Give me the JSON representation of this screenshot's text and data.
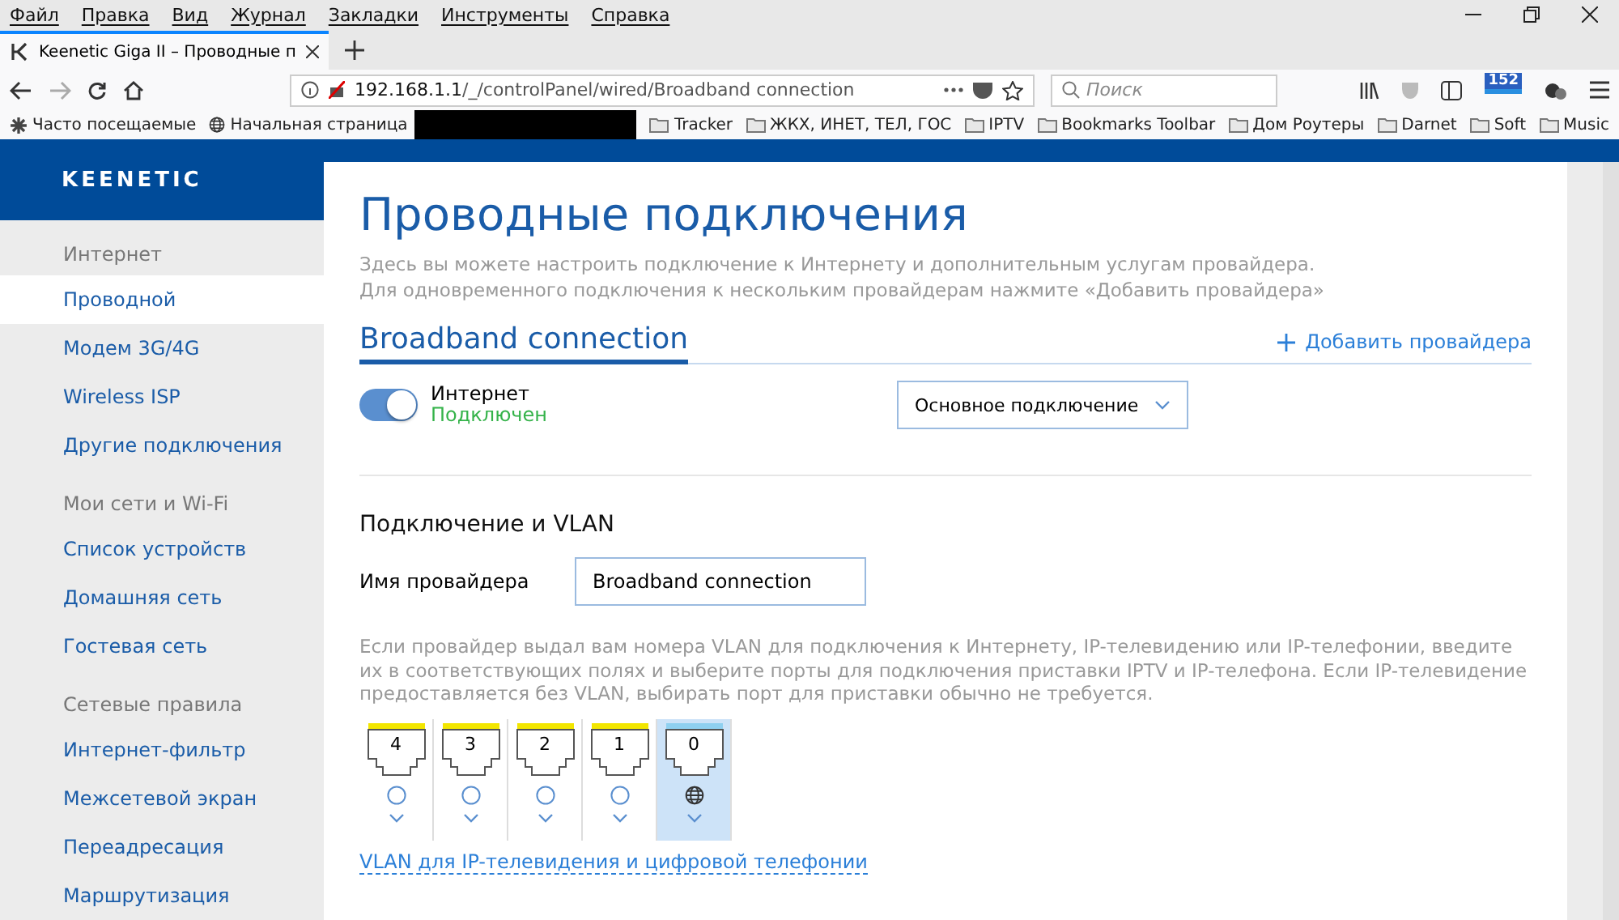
{
  "menu_bar": [
    "Файл",
    "Правка",
    "Вид",
    "Журнал",
    "Закладки",
    "Инструменты",
    "Справка"
  ],
  "tab": {
    "title": "Keenetic Giga II – Проводные п",
    "selected": true
  },
  "address": {
    "host": "192.168.1.1",
    "path": "/_/controlPanel/wired/Broadband connection"
  },
  "search": {
    "placeholder": "Поиск"
  },
  "notification_badge": "152",
  "bookmarks": [
    {
      "label": "Часто посещаемые",
      "kind": "gear"
    },
    {
      "label": "Начальная страница",
      "kind": "globe"
    },
    {
      "label": "Tracker",
      "kind": "folder"
    },
    {
      "label": "ЖКХ, ИНЕТ, ТЕЛ, ГОС",
      "kind": "folder"
    },
    {
      "label": "IPTV",
      "kind": "folder"
    },
    {
      "label": "Bookmarks Toolbar",
      "kind": "folder"
    },
    {
      "label": "Дом Роутеры",
      "kind": "folder"
    },
    {
      "label": "Darnet",
      "kind": "folder"
    },
    {
      "label": "Soft",
      "kind": "folder"
    },
    {
      "label": "Music",
      "kind": "folder"
    }
  ],
  "logo": "KEENETIC",
  "sidebar": [
    {
      "heading": "Интернет",
      "items": [
        {
          "label": "Проводной",
          "selected": true
        },
        {
          "label": "Модем 3G/4G",
          "selected": false
        },
        {
          "label": "Wireless ISP",
          "selected": false
        },
        {
          "label": "Другие подключения",
          "selected": false
        }
      ]
    },
    {
      "heading": "Мои сети и Wi-Fi",
      "items": [
        {
          "label": "Список устройств",
          "selected": false
        },
        {
          "label": "Домашняя сеть",
          "selected": false
        },
        {
          "label": "Гостевая сеть",
          "selected": false
        }
      ]
    },
    {
      "heading": "Сетевые правила",
      "items": [
        {
          "label": "Интернет-фильтр",
          "selected": false
        },
        {
          "label": "Межсетевой экран",
          "selected": false
        },
        {
          "label": "Переадресация",
          "selected": false
        },
        {
          "label": "Маршрутизация",
          "selected": false
        }
      ]
    }
  ],
  "page": {
    "title": "Проводные подключения",
    "description": "Здесь вы можете настроить подключение к Интернету и дополнительным услугам провайдера. Для одновременного подключения к нескольким провайдерам нажмите «Добавить провайдера»"
  },
  "connection_tab": {
    "label": "Broadband connection",
    "selected": true
  },
  "add_provider": "Добавить провайдера",
  "internet_switch": {
    "label": "Интернет",
    "status": "Подключен",
    "on": true
  },
  "priority_select": {
    "value": "Основное подключение"
  },
  "vlan_section": {
    "title": "Подключение и VLAN",
    "provider_label": "Имя провайдера",
    "provider_value": "Broadband connection",
    "hint": "Если провайдер выдал вам номера VLAN для подключения к Интернету, IP-телевидению или IP-телефонии, введите их в соответствующих полях и выберите порты для подключения приставки IPTV и IP-телефона. Если IP-телевидение предоставляется без VLAN, выбирать порт для приставки обычно не требуется.",
    "ports": [
      {
        "number": "4",
        "color": "#f2e600",
        "kind": "radio",
        "selected": false
      },
      {
        "number": "3",
        "color": "#f2e600",
        "kind": "radio",
        "selected": false
      },
      {
        "number": "2",
        "color": "#f2e600",
        "kind": "radio",
        "selected": false
      },
      {
        "number": "1",
        "color": "#f2e600",
        "kind": "radio",
        "selected": false
      },
      {
        "number": "0",
        "color": "#8fd0f0",
        "kind": "globe",
        "selected": true
      }
    ],
    "link": "VLAN для IP-телевидения и цифровой телефонии"
  }
}
